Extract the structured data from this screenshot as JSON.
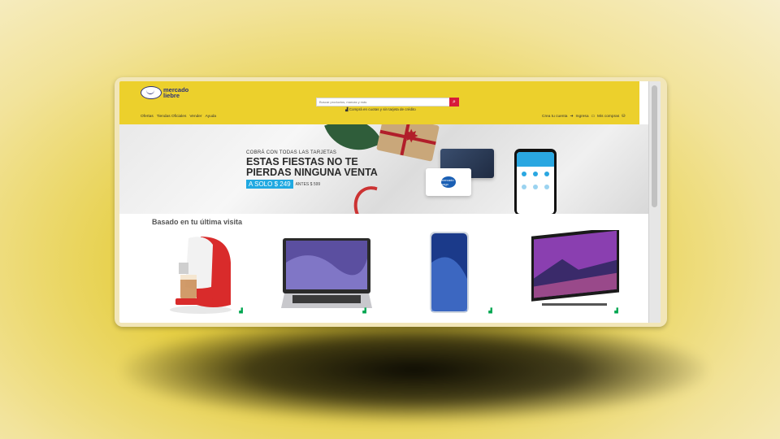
{
  "logo": {
    "line1": "mercado",
    "line2": "liebre"
  },
  "search": {
    "placeholder": "Buscar productos, marcas y más"
  },
  "promo": {
    "text": "Comprá en cuotas y sin tarjeta de crédito"
  },
  "nav_left": [
    "Ofertas",
    "Tiendas Oficiales",
    "Vender",
    "Ayuda"
  ],
  "nav_right": {
    "create": "Crea tu cuenta",
    "login": "Ingresa",
    "purchases": "Mis compras"
  },
  "banner": {
    "sub": "COBRÁ CON TODAS LAS TARJETAS",
    "title_line1": "ESTAS FIESTAS NO TE",
    "title_line2": "PIERDAS NINGUNA VENTA",
    "price": "A SOLO $ 249",
    "before": "ANTES $ 599",
    "card_logo": "mercado pago"
  },
  "section": {
    "title": "Basado en tu última visita"
  },
  "products": [
    {
      "name": "coffee-machine"
    },
    {
      "name": "laptop"
    },
    {
      "name": "smartphone"
    },
    {
      "name": "television"
    }
  ],
  "colors": {
    "header": "#ecd02c",
    "accent": "#d71b3a",
    "shipping": "#00a650",
    "price_badge": "#21a9e1"
  }
}
